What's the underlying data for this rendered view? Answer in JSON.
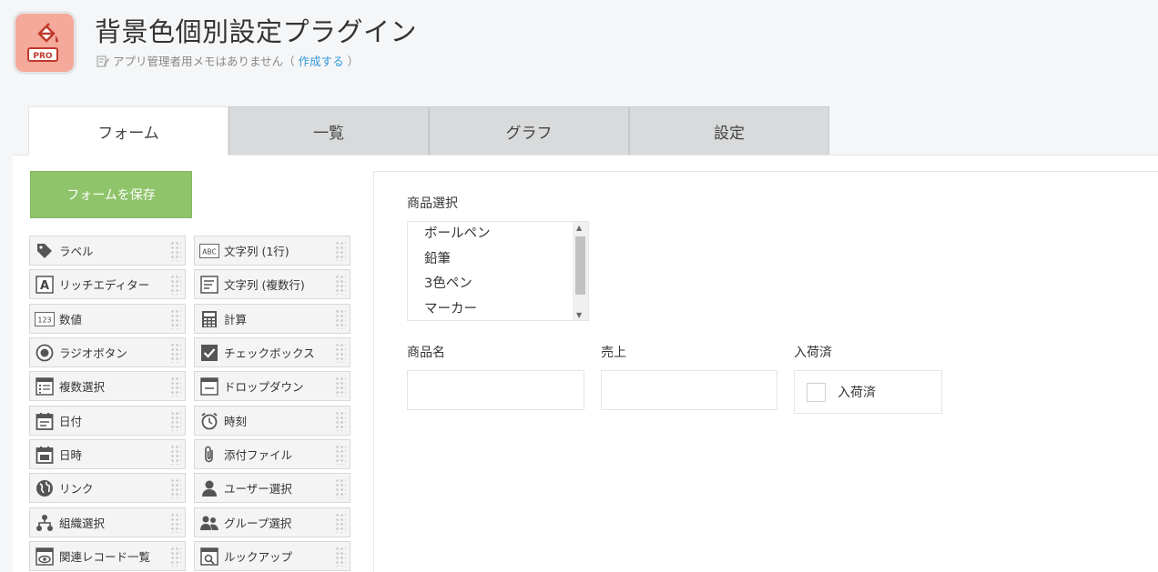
{
  "app": {
    "title": "背景色個別設定プラグイン",
    "icon_badge": "PRO",
    "memo_text": "アプリ管理者用メモはありません（",
    "memo_link": "作成する",
    "memo_close": "）"
  },
  "tabs": [
    {
      "label": "フォーム",
      "active": true
    },
    {
      "label": "一覧",
      "active": false
    },
    {
      "label": "グラフ",
      "active": false
    },
    {
      "label": "設定",
      "active": false
    }
  ],
  "toolbar": {
    "save_label": "フォームを保存"
  },
  "palette": [
    {
      "label": "ラベル",
      "icon": "tag-icon"
    },
    {
      "label": "文字列 (1行)",
      "icon": "abc-icon"
    },
    {
      "label": "リッチエディター",
      "icon": "rich-editor-icon"
    },
    {
      "label": "文字列 (複数行)",
      "icon": "multiline-icon"
    },
    {
      "label": "数値",
      "icon": "number-icon"
    },
    {
      "label": "計算",
      "icon": "calculator-icon"
    },
    {
      "label": "ラジオボタン",
      "icon": "radio-icon"
    },
    {
      "label": "チェックボックス",
      "icon": "checkbox-icon"
    },
    {
      "label": "複数選択",
      "icon": "multi-select-icon"
    },
    {
      "label": "ドロップダウン",
      "icon": "dropdown-icon"
    },
    {
      "label": "日付",
      "icon": "date-icon"
    },
    {
      "label": "時刻",
      "icon": "clock-icon"
    },
    {
      "label": "日時",
      "icon": "datetime-icon"
    },
    {
      "label": "添付ファイル",
      "icon": "paperclip-icon"
    },
    {
      "label": "リンク",
      "icon": "globe-icon"
    },
    {
      "label": "ユーザー選択",
      "icon": "user-icon"
    },
    {
      "label": "組織選択",
      "icon": "org-icon"
    },
    {
      "label": "グループ選択",
      "icon": "group-icon"
    },
    {
      "label": "関連レコード一覧",
      "icon": "related-records-icon"
    },
    {
      "label": "ルックアップ",
      "icon": "lookup-icon"
    }
  ],
  "form": {
    "product_select": {
      "label": "商品選択",
      "options": [
        "ボールペン",
        "鉛筆",
        "3色ペン",
        "マーカー"
      ]
    },
    "product_name": {
      "label": "商品名",
      "value": ""
    },
    "sales": {
      "label": "売上",
      "value": ""
    },
    "in_stock": {
      "label": "入荷済",
      "option": "入荷済",
      "checked": false
    }
  },
  "colors": {
    "accent_green": "#8fc46a",
    "link_blue": "#3498db",
    "icon_red": "#f4a99a"
  }
}
